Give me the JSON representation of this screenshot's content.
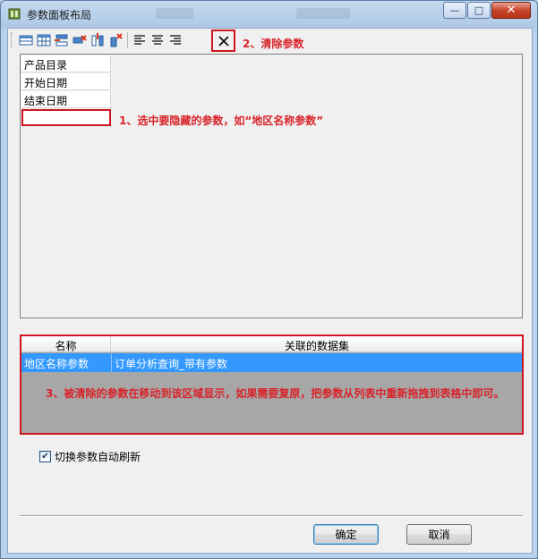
{
  "window": {
    "title": "参数面板布局"
  },
  "toolbar": {
    "icons": [
      "layout-grid-icon",
      "layout-table-icon",
      "insert-row-icon",
      "delete-row-icon",
      "insert-column-icon",
      "delete-column-icon",
      "align-left-icon",
      "align-center-icon",
      "align-right-icon",
      "clear-params-icon"
    ]
  },
  "annotations": {
    "step1": "1、选中要隐藏的参数，如“地区名称参数”",
    "step2": "2、清除参数",
    "step3": "3、被清除的参数在移动到该区域显示，如果需要复原，把参数从列表中重新拖拽到表格中即可。"
  },
  "param_layout": {
    "cells": [
      "产品目录",
      "开始日期",
      "结束日期",
      ""
    ]
  },
  "removed_params": {
    "columns": [
      "名称",
      "关联的数据集"
    ],
    "rows": [
      {
        "name": "地区名称参数",
        "dataset": "订单分析查询_带有参数"
      }
    ]
  },
  "options": {
    "auto_refresh_label": "切换参数自动刷新",
    "auto_refresh_checked": true
  },
  "buttons": {
    "ok": "确定",
    "cancel": "取消"
  },
  "colors": {
    "annotation_red": "#d8232a",
    "selection_blue": "#3399ff",
    "highlight_box": "#d0161d"
  }
}
